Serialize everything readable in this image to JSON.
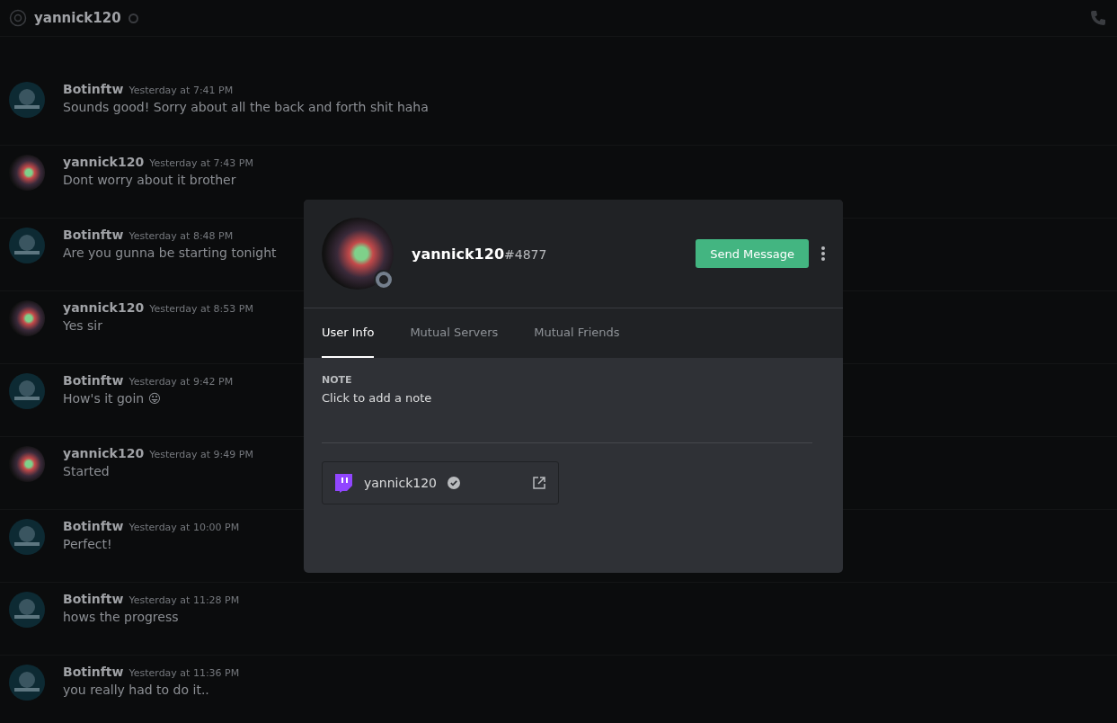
{
  "header": {
    "channel": "yannick120"
  },
  "messages": [
    {
      "author": "Botinftw",
      "kind": "bot",
      "timestamp": "Yesterday at 7:41 PM",
      "text": "Sounds good! Sorry about all the back and forth shit haha"
    },
    {
      "author": "yannick120",
      "kind": "nebula",
      "timestamp": "Yesterday at 7:43 PM",
      "text": "Dont worry about it brother"
    },
    {
      "author": "Botinftw",
      "kind": "bot",
      "timestamp": "Yesterday at 8:48 PM",
      "text": "Are you gunna be starting tonight"
    },
    {
      "author": "yannick120",
      "kind": "nebula",
      "timestamp": "Yesterday at 8:53 PM",
      "text": "Yes sir"
    },
    {
      "author": "Botinftw",
      "kind": "bot",
      "timestamp": "Yesterday at 9:42 PM",
      "text": "How's it goin 😛"
    },
    {
      "author": "yannick120",
      "kind": "nebula",
      "timestamp": "Yesterday at 9:49 PM",
      "text": "Started"
    },
    {
      "author": "Botinftw",
      "kind": "bot",
      "timestamp": "Yesterday at 10:00 PM",
      "text": "Perfect!"
    },
    {
      "author": "Botinftw",
      "kind": "bot",
      "timestamp": "Yesterday at 11:28 PM",
      "text": "hows the progress"
    },
    {
      "author": "Botinftw",
      "kind": "bot",
      "timestamp": "Yesterday at 11:36 PM",
      "text": "you really had to do it.."
    }
  ],
  "profile": {
    "username": "yannick120",
    "discriminator": "#4877",
    "online": false,
    "send_button": "Send Message",
    "tabs": [
      {
        "label": "User Info",
        "selected": true
      },
      {
        "label": "Mutual Servers",
        "selected": false
      },
      {
        "label": "Mutual Friends",
        "selected": false
      }
    ],
    "note": {
      "heading": "NOTE",
      "placeholder": "Click to add a note"
    },
    "connections": [
      {
        "kind": "twitch",
        "name": "yannick120",
        "verified": true
      }
    ]
  }
}
